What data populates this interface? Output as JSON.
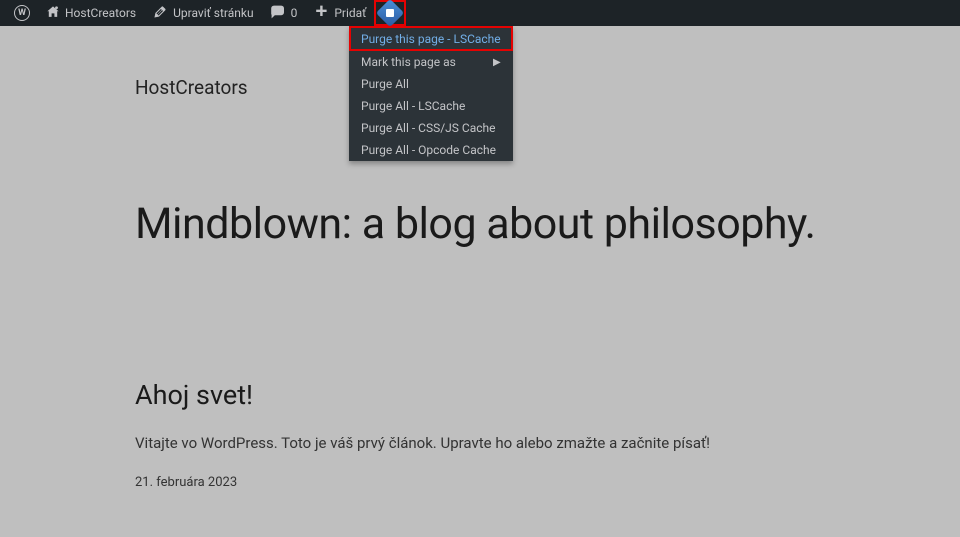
{
  "adminbar": {
    "site_name": "HostCreators",
    "edit_label": "Upraviť stránku",
    "comments_count": "0",
    "add_label": "Pridať"
  },
  "dropdown": {
    "items": [
      {
        "label": "Purge this page - LSCache",
        "highlighted": true
      },
      {
        "label": "Mark this page as",
        "submenu": true
      },
      {
        "label": "Purge All"
      },
      {
        "label": "Purge All - LSCache"
      },
      {
        "label": "Purge All - CSS/JS Cache"
      },
      {
        "label": "Purge All - Opcode Cache"
      }
    ]
  },
  "page": {
    "site_title": "HostCreators",
    "main_heading": "Mindblown: a blog about philosophy.",
    "post": {
      "title": "Ahoj svet!",
      "excerpt": "Vitajte vo WordPress. Toto je váš prvý článok. Upravte ho alebo zmažte a začnite písať!",
      "date": "21. februára 2023"
    }
  }
}
